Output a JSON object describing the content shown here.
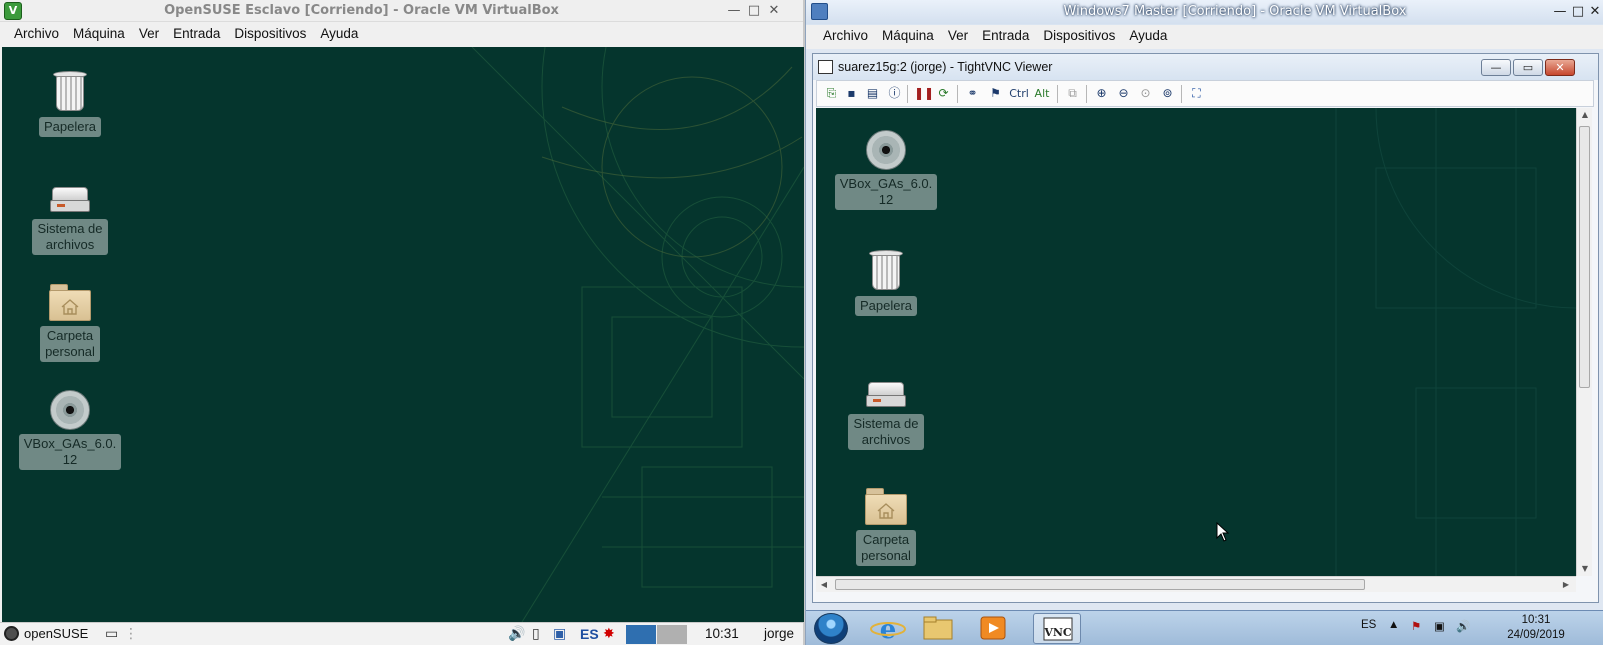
{
  "left_window": {
    "title": "OpenSUSE Esclavo [Corriendo] - Oracle VM VirtualBox",
    "controls": {
      "minimize": "—",
      "maximize": "□",
      "close": "✕"
    },
    "menu": [
      "Archivo",
      "Máquina",
      "Ver",
      "Entrada",
      "Dispositivos",
      "Ayuda"
    ],
    "desktop_icons": [
      {
        "label": "Papelera",
        "icon": "trash-icon"
      },
      {
        "label_line1": "Sistema de",
        "label_line2": "archivos",
        "icon": "hdd-icon"
      },
      {
        "label_line1": "Carpeta",
        "label_line2": "personal",
        "icon": "home-folder-icon"
      },
      {
        "label_line1": "VBox_GAs_6.0.",
        "label_line2": "12",
        "icon": "disc-icon"
      }
    ],
    "taskbar": {
      "start_label": "openSUSE",
      "keyboard_layout": "ES",
      "clock": "10:31",
      "user": "jorge"
    }
  },
  "right_window": {
    "title": "Windows7 Master [Corriendo] - Oracle VM VirtualBox",
    "controls": {
      "minimize": "—",
      "maximize": "□",
      "close": "✕"
    },
    "menu": [
      "Archivo",
      "Máquina",
      "Ver",
      "Entrada",
      "Dispositivos",
      "Ayuda"
    ],
    "vnc": {
      "title": "suarez15g:2 (jorge) - TightVNC Viewer",
      "toolbar_ctrl": "Ctrl",
      "toolbar_alt": "Alt",
      "desktop_icons": [
        {
          "label_line1": "VBox_GAs_6.0.",
          "label_line2": "12",
          "icon": "disc-icon"
        },
        {
          "label": "Papelera",
          "icon": "trash-icon"
        },
        {
          "label_line1": "Sistema de",
          "label_line2": "archivos",
          "icon": "hdd-icon"
        },
        {
          "label_line1": "Carpeta",
          "label_line2": "personal",
          "icon": "home-folder-icon"
        }
      ]
    },
    "taskbar": {
      "language": "ES",
      "time": "10:31",
      "date": "24/09/2019"
    }
  },
  "colors": {
    "desktop_bg": "#05352d",
    "win7_taskbar": "#9fbbd9"
  }
}
